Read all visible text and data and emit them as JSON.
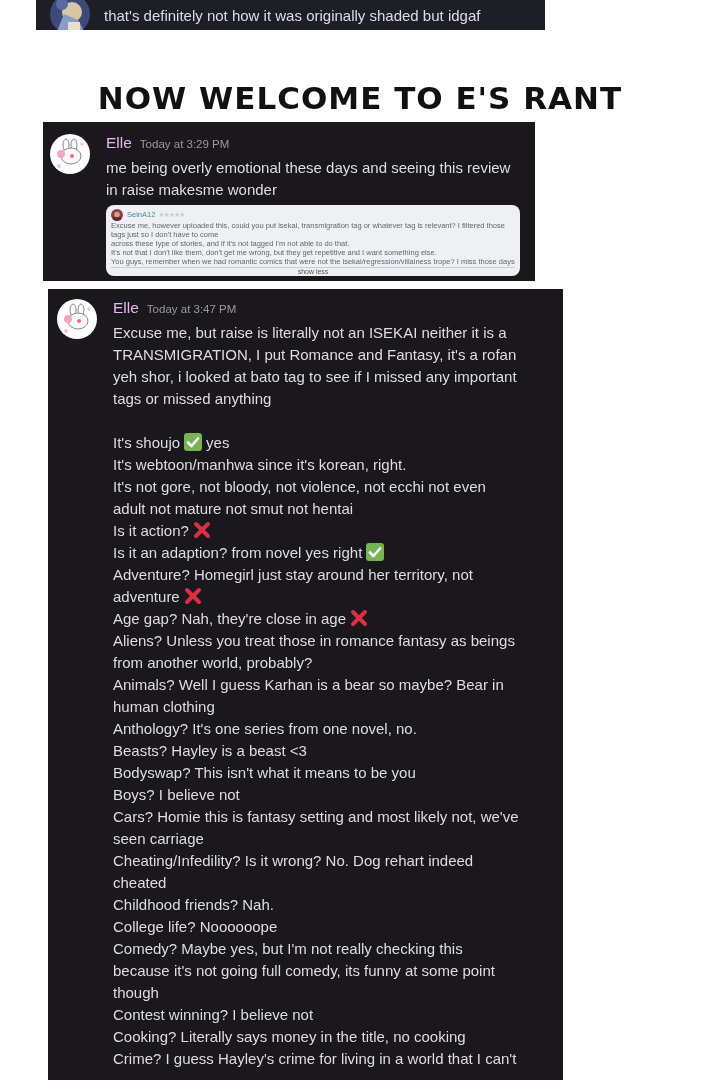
{
  "top_message": {
    "text": "that's definitely not how it was originally shaded but idgaf"
  },
  "heading": "NOW WELCOME TO E'S RANT",
  "messages": [
    {
      "author": "Elle",
      "time": "Today at 3:29 PM",
      "paragraphs": [
        [
          [
            {
              "kind": "text",
              "text": "me being overly emotional these days and seeing this review"
            }
          ],
          [
            {
              "kind": "text",
              "text": "in raise makesme wonder"
            }
          ]
        ]
      ],
      "embed": {
        "user": "SeinA12",
        "lines": [
          "Excuse me, however uploaded this, could you put isekai, transmigration tag or whatever tag is relevant? I filtered those tags just so I don't have to come",
          "across these type of stories, and if it's not tagged I'm not able to do that.",
          "It's not that I don't like them, don't get me wrong, but they get repetitive and I want something else.",
          "You guys, remember when we had romantic comics that were not the isekai/regression/villainess trope? I miss those days"
        ],
        "toggle": "show less"
      }
    },
    {
      "author": "Elle",
      "time": "Today at 3:47 PM",
      "paragraphs": [
        [
          [
            {
              "kind": "text",
              "text": "Excuse me, but raise is literally not an ISEKAI neither it is a"
            }
          ],
          [
            {
              "kind": "text",
              "text": "TRANSMIGRATION, I put Romance and Fantasy, it's a rofan"
            }
          ],
          [
            {
              "kind": "text",
              "text": "yeh shor, i looked at bato tag to see if I missed any important"
            }
          ],
          [
            {
              "kind": "text",
              "text": "tags or missed anything"
            }
          ]
        ],
        [
          [
            {
              "kind": "text",
              "text": "It's shoujo"
            },
            {
              "kind": "check"
            },
            {
              "kind": "text",
              "text": "yes"
            }
          ],
          [
            {
              "kind": "text",
              "text": "It's webtoon/manhwa since it's korean, right."
            }
          ],
          [
            {
              "kind": "text",
              "text": "It's not gore, not bloody, not violence, not ecchi not even"
            }
          ],
          [
            {
              "kind": "text",
              "text": "adult not mature not smut not hentai"
            }
          ],
          [
            {
              "kind": "text",
              "text": "Is it action?"
            },
            {
              "kind": "cross"
            }
          ],
          [
            {
              "kind": "text",
              "text": "Is it an adaption? from novel yes right"
            },
            {
              "kind": "check"
            }
          ],
          [
            {
              "kind": "text",
              "text": "Adventure? Homegirl just stay around her territory, not"
            }
          ],
          [
            {
              "kind": "text",
              "text": "adventure"
            },
            {
              "kind": "cross"
            }
          ],
          [
            {
              "kind": "text",
              "text": "Age gap? Nah, they're close in age"
            },
            {
              "kind": "cross"
            }
          ],
          [
            {
              "kind": "text",
              "text": "Aliens? Unless you treat those in romance fantasy as beings"
            }
          ],
          [
            {
              "kind": "text",
              "text": "from another world, probably?"
            }
          ],
          [
            {
              "kind": "text",
              "text": "Animals? Well I guess Karhan is a bear so maybe? Bear in"
            }
          ],
          [
            {
              "kind": "text",
              "text": "human clothing"
            }
          ],
          [
            {
              "kind": "text",
              "text": "Anthology? It's one series from one novel, no."
            }
          ],
          [
            {
              "kind": "text",
              "text": "Beasts? Hayley is a beast <3"
            }
          ],
          [
            {
              "kind": "text",
              "text": "Bodyswap? This isn't what it means to be you"
            }
          ],
          [
            {
              "kind": "text",
              "text": "Boys? I believe not"
            }
          ],
          [
            {
              "kind": "text",
              "text": "Cars? Homie this is fantasy setting and most likely not, we've"
            }
          ],
          [
            {
              "kind": "text",
              "text": "seen carriage"
            }
          ],
          [
            {
              "kind": "text",
              "text": "Cheating/Infedility? Is it wrong? No. Dog rehart indeed"
            }
          ],
          [
            {
              "kind": "text",
              "text": "cheated"
            }
          ],
          [
            {
              "kind": "text",
              "text": "Childhood friends? Nah."
            }
          ],
          [
            {
              "kind": "text",
              "text": "College life? Noooooope"
            }
          ],
          [
            {
              "kind": "text",
              "text": "Comedy? Maybe yes, but I'm not really checking this"
            }
          ],
          [
            {
              "kind": "text",
              "text": "because it's not going full comedy, its funny at some point"
            }
          ],
          [
            {
              "kind": "text",
              "text": "though"
            }
          ],
          [
            {
              "kind": "text",
              "text": "Contest winning? I believe not"
            }
          ],
          [
            {
              "kind": "text",
              "text": "Cooking? Literally says money in the title, no cooking"
            }
          ],
          [
            {
              "kind": "text",
              "text": "Crime? I guess Hayley's crime for living in a world that I can't"
            }
          ]
        ]
      ]
    }
  ]
}
